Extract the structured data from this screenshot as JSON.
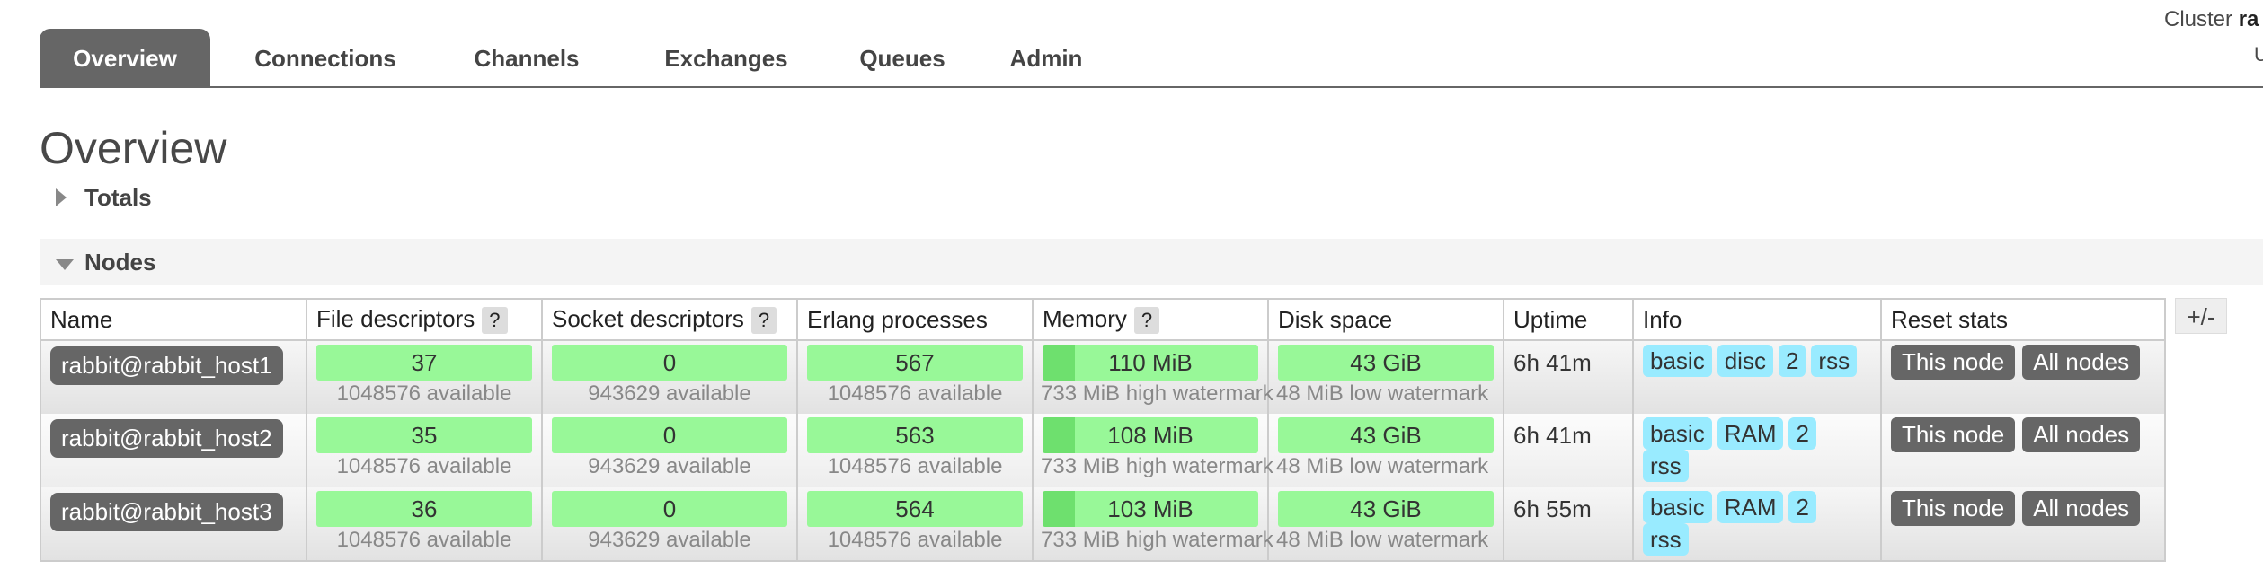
{
  "cluster": {
    "prefix": "Cluster",
    "name": "ra",
    "second_line": "U"
  },
  "tabs": [
    {
      "label": "Overview"
    },
    {
      "label": "Connections"
    },
    {
      "label": "Channels"
    },
    {
      "label": "Exchanges"
    },
    {
      "label": "Queues"
    },
    {
      "label": "Admin"
    }
  ],
  "page_title": "Overview",
  "sections": {
    "totals": "Totals",
    "nodes": "Nodes"
  },
  "columns": {
    "name": "Name",
    "file_descriptors": "File descriptors",
    "socket_descriptors": "Socket descriptors",
    "erlang_processes": "Erlang processes",
    "memory": "Memory",
    "disk_space": "Disk space",
    "uptime": "Uptime",
    "info": "Info",
    "reset_stats": "Reset stats",
    "help": "?"
  },
  "plus_minus": "+/-",
  "nodes": [
    {
      "name": "rabbit@rabbit_host1",
      "fd_used": "37",
      "fd_available": "1048576 available",
      "sd_used": "0",
      "sd_available": "943629 available",
      "ep_used": "567",
      "ep_available": "1048576 available",
      "memory": "110 MiB",
      "memory_watermark": "733 MiB high watermark",
      "disk": "43 GiB",
      "disk_watermark": "48 MiB low watermark",
      "uptime": "6h 41m",
      "info": [
        "basic",
        "disc",
        "2",
        "rss"
      ],
      "reset": [
        "This node",
        "All nodes"
      ]
    },
    {
      "name": "rabbit@rabbit_host2",
      "fd_used": "35",
      "fd_available": "1048576 available",
      "sd_used": "0",
      "sd_available": "943629 available",
      "ep_used": "563",
      "ep_available": "1048576 available",
      "memory": "108 MiB",
      "memory_watermark": "733 MiB high watermark",
      "disk": "43 GiB",
      "disk_watermark": "48 MiB low watermark",
      "uptime": "6h 41m",
      "info": [
        "basic",
        "RAM",
        "2",
        "rss"
      ],
      "reset": [
        "This node",
        "All nodes"
      ]
    },
    {
      "name": "rabbit@rabbit_host3",
      "fd_used": "36",
      "fd_available": "1048576 available",
      "sd_used": "0",
      "sd_available": "943629 available",
      "ep_used": "564",
      "ep_available": "1048576 available",
      "memory": "103 MiB",
      "memory_watermark": "733 MiB high watermark",
      "disk": "43 GiB",
      "disk_watermark": "48 MiB low watermark",
      "uptime": "6h 55m",
      "info": [
        "basic",
        "RAM",
        "2",
        "rss"
      ],
      "reset": [
        "This node",
        "All nodes"
      ]
    }
  ],
  "colors": {
    "tab_active": "#666666",
    "bar_green": "#98f898",
    "pill_blue": "#99ebff"
  }
}
